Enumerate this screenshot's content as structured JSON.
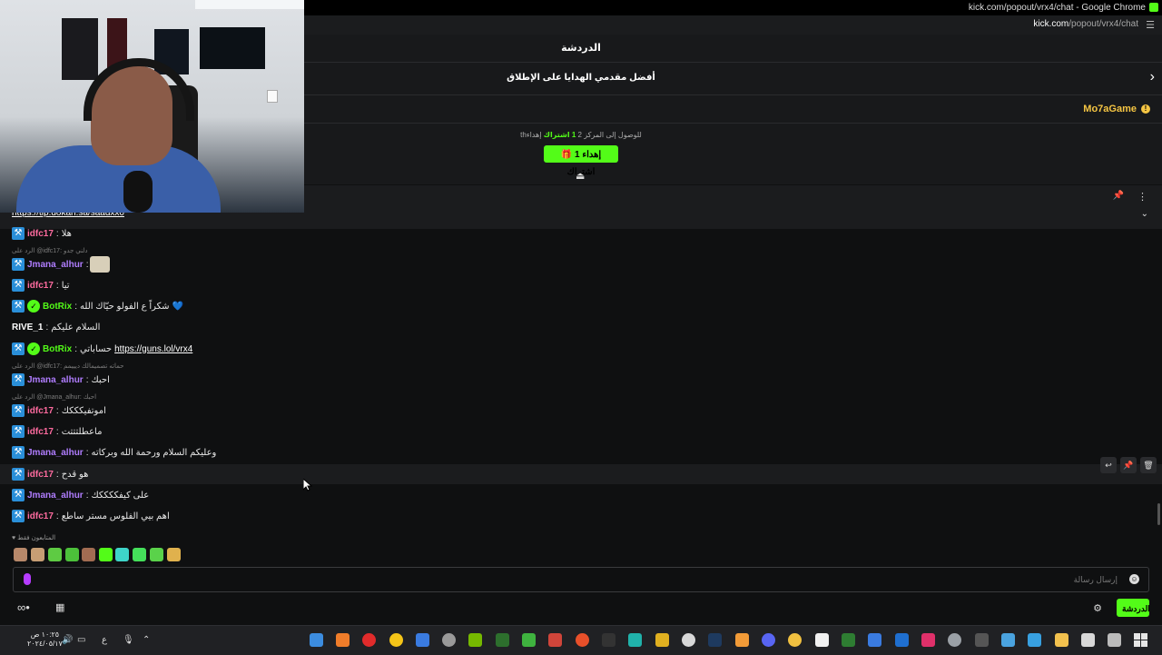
{
  "browser": {
    "title": "kick.com/popout/vrx4/chat - Google Chrome",
    "url_host": "kick.com",
    "url_path": "/popout/vrx4/chat"
  },
  "chat_header": {
    "title": "الدردشة"
  },
  "leaderboard": {
    "title": "أفضل مقدمي الهدايا على الإطلاق"
  },
  "top_gifter": {
    "name": "Mo7aGame"
  },
  "gift_goal": {
    "prefix": "للوصول إلى المركز 2",
    "amount": "1 اشتراك",
    "suffix": "إهداء",
    "th": "th",
    "button_label": "إهداء 1 اشتراك"
  },
  "pinned": {
    "link": "https://tip.dokan.sa/saadxx0"
  },
  "messages": [
    {
      "user": "idfc17",
      "color": "pink",
      "text": "هلا",
      "badge": "mod"
    },
    {
      "reply": "الرد على @idfc17: دلني جدو"
    },
    {
      "user": "Jmana_alhur",
      "color": "purple",
      "text": "",
      "badge": "mod",
      "emote": true
    },
    {
      "user": "idfc17",
      "color": "pink",
      "text": "تيا",
      "badge": "mod"
    },
    {
      "user": "BotRix",
      "color": "green",
      "text": "شكراً ع الفولو حيّاك الله",
      "badge": "mod",
      "verified": true,
      "heart": true
    },
    {
      "user": "RIVE_1",
      "color": "white",
      "text": "السلام عليكم"
    },
    {
      "user": "BotRix",
      "color": "green",
      "text": "حساباتي",
      "badge": "mod",
      "verified": true,
      "link": "https://guns.lol/vrx4"
    },
    {
      "reply": "الرد على @idfc17: حماته تصميمالك ديييمم"
    },
    {
      "user": "Jmana_alhur",
      "color": "purple",
      "text": "احبك",
      "badge": "mod"
    },
    {
      "reply": "الرد على @Jmana_alhur: احبك"
    },
    {
      "user": "idfc17",
      "color": "pink",
      "text": "اموتفيكككك",
      "badge": "mod"
    },
    {
      "user": "idfc17",
      "color": "pink",
      "text": "ماعطلتتتت",
      "badge": "mod"
    },
    {
      "user": "Jmana_alhur",
      "color": "purple",
      "text": "وعليكم السلام ورحمة الله وبركاته",
      "badge": "mod"
    },
    {
      "user": "idfc17",
      "color": "pink",
      "text": "هو قدح",
      "badge": "mod"
    },
    {
      "user": "Jmana_alhur",
      "color": "purple",
      "text": "على كيفككككك",
      "badge": "mod"
    },
    {
      "user": "idfc17",
      "color": "pink",
      "text": "اهم بيي الفلوس مستر ساطع",
      "badge": "mod"
    }
  ],
  "emote_bar": {
    "label": "المتابعون فقط"
  },
  "input": {
    "placeholder": "إرسال رسالة"
  },
  "footer": {
    "chat_button": "الدردشة"
  },
  "taskbar": {
    "time": "١٠:٢٥ ص",
    "date": "٢٠٢٤/٠٥/١٧",
    "lang": "ع"
  },
  "colors": {
    "accent": "#53fc18",
    "gifter": "#f5c543",
    "mod_badge": "#2a8fd9"
  }
}
